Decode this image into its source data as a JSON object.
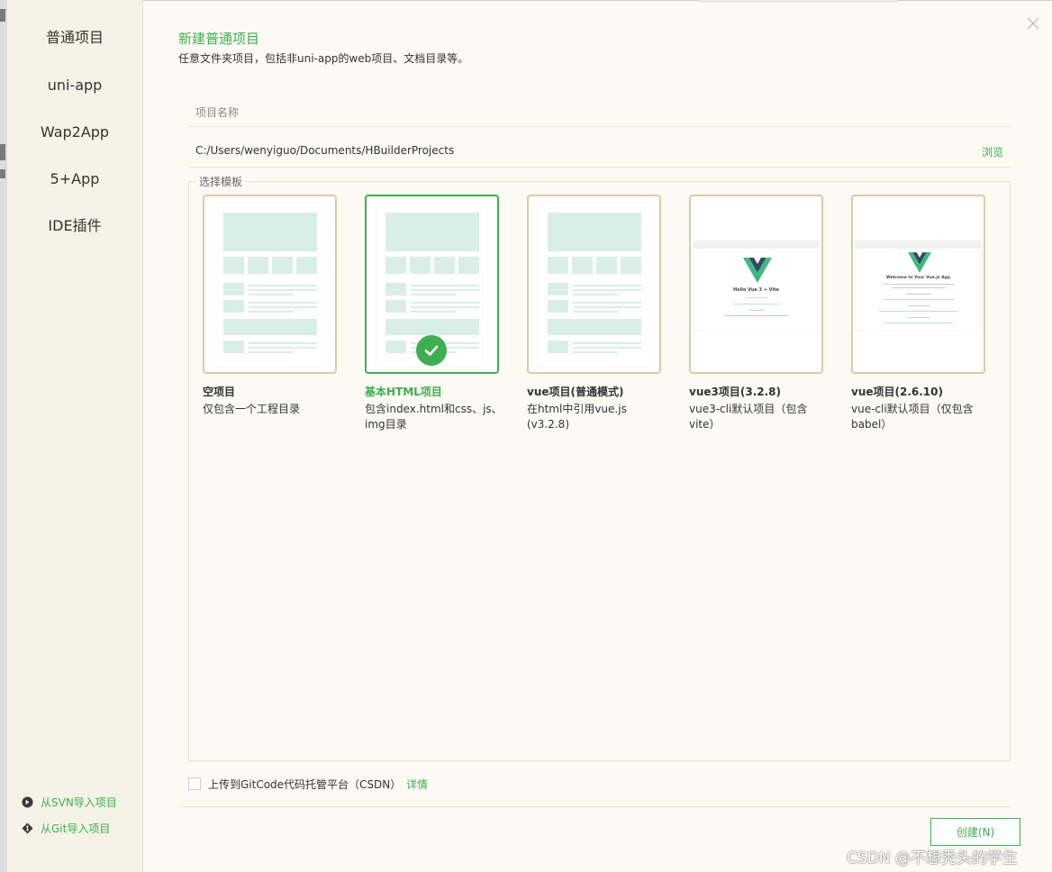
{
  "sidebar": {
    "items": [
      {
        "label": "普通项目",
        "active": true
      },
      {
        "label": "uni-app",
        "active": false
      },
      {
        "label": "Wap2App",
        "active": false
      },
      {
        "label": "5+App",
        "active": false
      },
      {
        "label": "IDE插件",
        "active": false
      }
    ],
    "import_svn": "从SVN导入项目",
    "import_git": "从Git导入项目"
  },
  "header": {
    "title": "新建普通项目",
    "subtitle": "任意文件夹项目，包括非uni-app的web项目、文档目录等。"
  },
  "form": {
    "name_placeholder": "项目名称",
    "name_value": "",
    "path": "C:/Users/wenyiguo/Documents/HBuilderProjects",
    "browse": "浏览"
  },
  "templates": {
    "legend": "选择模板",
    "selected_index": 1,
    "items": [
      {
        "title": "空项目",
        "desc": "仅包含一个工程目录",
        "thumb": "wireframe-icon"
      },
      {
        "title": "基本HTML项目",
        "desc": "包含index.html和css、js、img目录",
        "thumb": "wireframe-icon"
      },
      {
        "title": "vue项目(普通模式)",
        "desc": "在html中引用vue.js (v3.2.8)",
        "thumb": "wireframe-icon"
      },
      {
        "title": "vue3项目(3.2.8)",
        "desc": "vue3-cli默认项目（包含vite）",
        "thumb": "vue-logo-icon",
        "shot_heading": "Hello Vue 3 + Vite"
      },
      {
        "title": "vue项目(2.6.10)",
        "desc": "vue-cli默认项目（仅包含babel）",
        "thumb": "vue-logo-icon",
        "shot_heading": "Welcome to Your Vue.js App"
      }
    ]
  },
  "footer": {
    "upload_checked": false,
    "upload_label": "上传到GitCode代码托管平台（CSDN）",
    "details": "详情",
    "create": "创建(N)"
  },
  "watermark": "CSDN @不想秃头的学生",
  "colors": {
    "accent": "#3dae52",
    "card_border": "#d9cba5",
    "thumb_block": "#daeee8",
    "vue_green": "#41b883",
    "vue_dark": "#34495e"
  }
}
